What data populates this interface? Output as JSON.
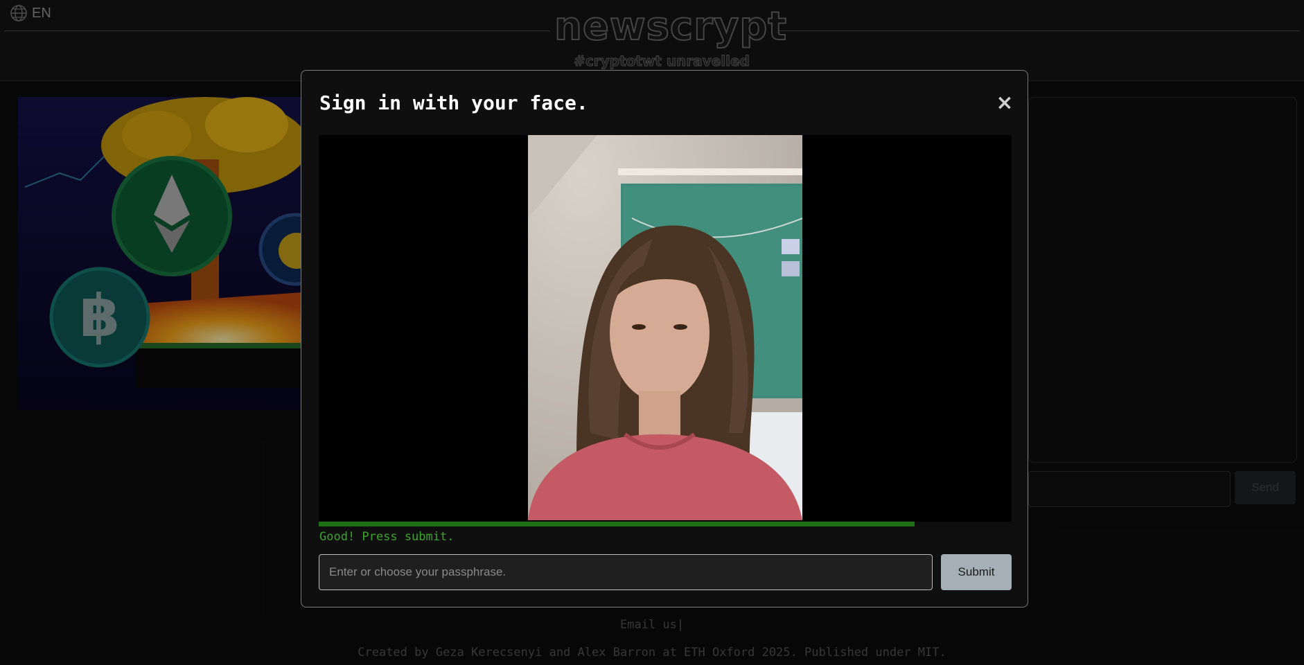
{
  "header": {
    "language": "EN",
    "logo_text": "newscrypt",
    "tagline": "#cryptotwt unravelled"
  },
  "chat": {
    "send_label": "Send"
  },
  "modal": {
    "title": "Sign in with your face.",
    "close_symbol": "×",
    "progress_fraction": 0.86,
    "status_text": "Good! Press submit.",
    "passphrase_placeholder": "Enter or choose your passphrase.",
    "passphrase_value": "",
    "submit_label": "Submit"
  },
  "footer": {
    "email_text": "Email us|",
    "credit_text": "Created by Geza Kerecsenyi and Alex Barron at ETH Oxford 2025. Published under MIT."
  },
  "icons": {
    "language": "globe-icon",
    "close": "close-icon"
  },
  "colors": {
    "status_green": "#3ba52c",
    "progress_green": "#1f6f17",
    "submit_bg": "#a4b0b6"
  }
}
